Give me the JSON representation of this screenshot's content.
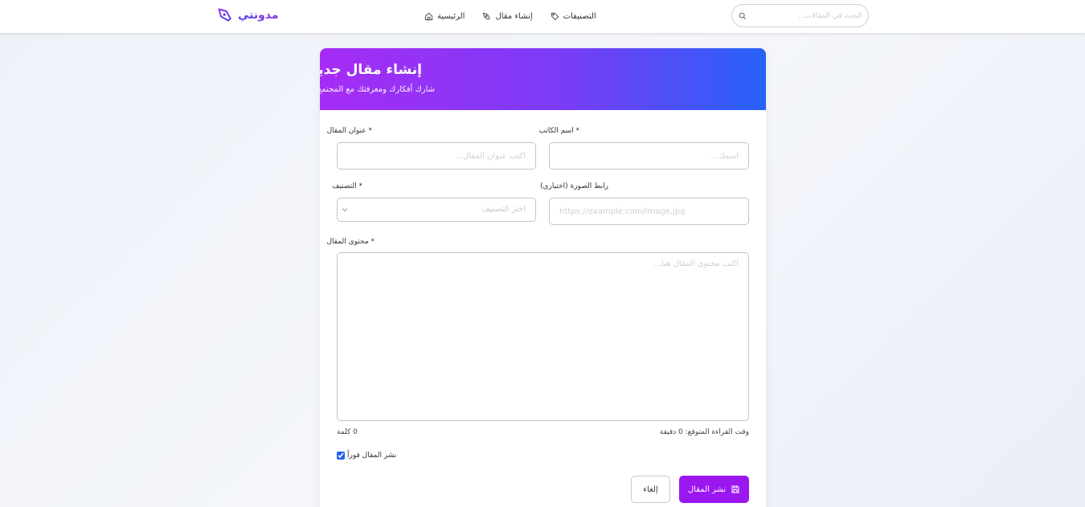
{
  "navbar": {
    "logo_text": "مدونتي",
    "links": [
      {
        "label": "الرئيسية",
        "icon": "home-icon"
      },
      {
        "label": "إنشاء مقال",
        "icon": "pen-icon"
      },
      {
        "label": "التصنيفات",
        "icon": "tag-icon"
      }
    ],
    "search": {
      "placeholder": "البحث في المقالات..."
    }
  },
  "card": {
    "title": "إنشاء مقال جديد",
    "subtitle": "شارك أفكارك ومعرفتك مع المجتمع"
  },
  "form": {
    "author": {
      "label": "* اسم الكاتب",
      "placeholder": "اسمك..."
    },
    "title": {
      "label": "* عنوان المقال",
      "placeholder": "اكتب عنوان المقال..."
    },
    "image": {
      "label": "رابط الصورة (اختياري)",
      "placeholder": "https://example.com/image.jpg"
    },
    "category": {
      "label": "* التصنيف",
      "selected": "اختر التصنيف"
    },
    "content": {
      "label": "* محتوى المقال",
      "placeholder": "اكتب محتوى المقال هنا..."
    },
    "reading_time": "وقت القراءة المتوقع: 0 دقيقة",
    "word_count": "0 كلمة",
    "publish_now": {
      "label": "نشر المقال فوراً",
      "checked": true
    },
    "cancel_label": "إلغاء",
    "submit_label": "نشر المقال"
  },
  "colors": {
    "accent": "#9b17f0",
    "header_gradient_start": "#a62cf4",
    "header_gradient_end": "#2562f8"
  }
}
